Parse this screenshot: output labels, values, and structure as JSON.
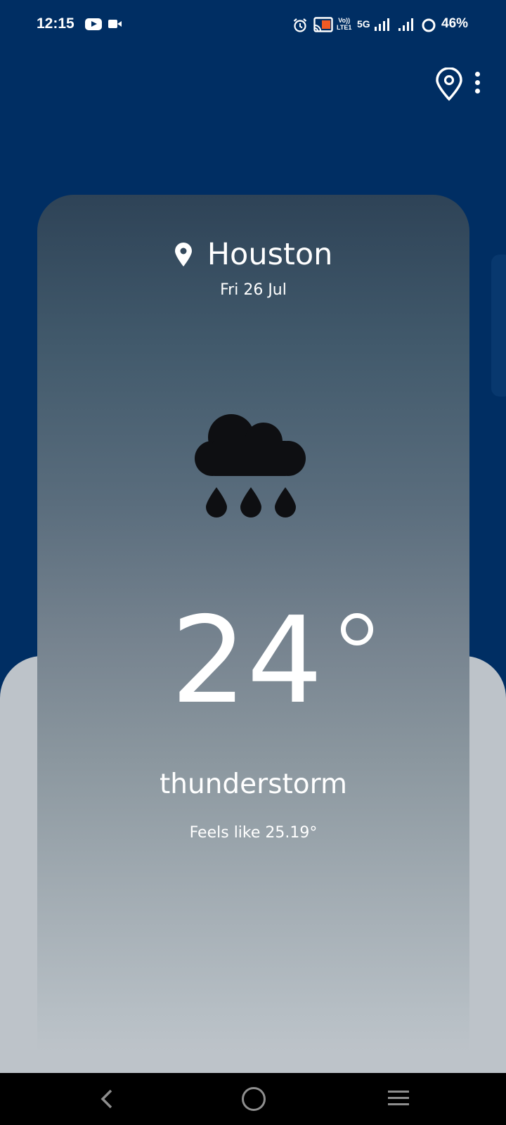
{
  "status_bar": {
    "time": "12:15",
    "battery": "46%",
    "network": "5G",
    "volte_top": "Vo))",
    "volte_bottom": "LTE1",
    "icons": [
      "youtube-icon",
      "video-camera-icon",
      "alarm-icon",
      "cast-icon",
      "signal-icon",
      "signal-icon",
      "battery-icon"
    ]
  },
  "toolbar": {
    "location_icon": "location-pin-outline-icon",
    "menu_icon": "more-vert-icon"
  },
  "weather": {
    "city": "Houston",
    "date": "Fri 26 Jul",
    "temperature": "24",
    "condition": "thunderstorm",
    "feels_like": "Feels like 25.19°",
    "icon": "cloud-rain-icon"
  },
  "colors": {
    "background": "#002e63",
    "bottom_panel": "#bdc3c9",
    "icon": "#0e0f12"
  }
}
